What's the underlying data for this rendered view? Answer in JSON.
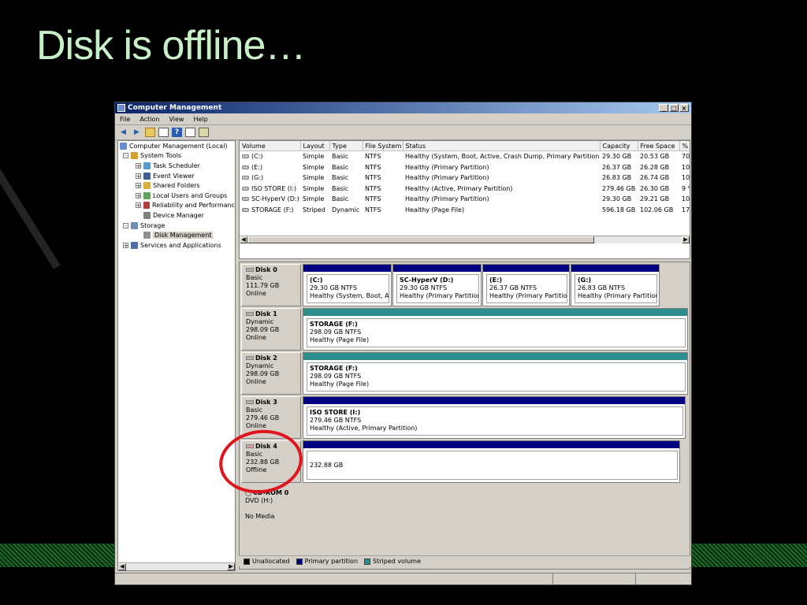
{
  "slide": {
    "title": "Disk is offline…"
  },
  "window": {
    "title": "Computer Management",
    "controls": {
      "minimize": "_",
      "maximize": "□",
      "close": "×"
    }
  },
  "menu": [
    "File",
    "Action",
    "View",
    "Help"
  ],
  "tree": [
    {
      "label": "Computer Management (Local)",
      "icon": "computer-icon"
    },
    {
      "label": "System Tools",
      "icon": "tools-icon",
      "expander": "-"
    },
    {
      "label": "Task Scheduler",
      "icon": "clock-icon",
      "expander": "+"
    },
    {
      "label": "Event Viewer",
      "icon": "event-viewer-icon",
      "expander": "+"
    },
    {
      "label": "Shared Folders",
      "icon": "shared-folder-icon",
      "expander": "+"
    },
    {
      "label": "Local Users and Groups",
      "icon": "users-icon",
      "expander": "+"
    },
    {
      "label": "Reliability and Performanc",
      "icon": "performance-icon",
      "expander": "+"
    },
    {
      "label": "Device Manager",
      "icon": "device-manager-icon"
    },
    {
      "label": "Storage",
      "icon": "storage-icon",
      "expander": "-"
    },
    {
      "label": "Disk Management",
      "icon": "disk-management-icon",
      "selected": true
    },
    {
      "label": "Services and Applications",
      "icon": "services-icon",
      "expander": "+"
    }
  ],
  "volume_table": {
    "headers": [
      "Volume",
      "Layout",
      "Type",
      "File System",
      "Status",
      "Capacity",
      "Free Space",
      "%"
    ],
    "rows": [
      [
        "(C:)",
        "Simple",
        "Basic",
        "NTFS",
        "Healthy (System, Boot, Active, Crash Dump, Primary Partition)",
        "29.30 GB",
        "20.53 GB",
        "70"
      ],
      [
        "(E:)",
        "Simple",
        "Basic",
        "NTFS",
        "Healthy (Primary Partition)",
        "26.37 GB",
        "26.28 GB",
        "10"
      ],
      [
        "(G:)",
        "Simple",
        "Basic",
        "NTFS",
        "Healthy (Primary Partition)",
        "26.83 GB",
        "26.74 GB",
        "10"
      ],
      [
        "ISO STORE (I:)",
        "Simple",
        "Basic",
        "NTFS",
        "Healthy (Active, Primary Partition)",
        "279.46 GB",
        "26.30 GB",
        "9 %"
      ],
      [
        "SC-HyperV (D:)",
        "Simple",
        "Basic",
        "NTFS",
        "Healthy (Primary Partition)",
        "29.30 GB",
        "29.21 GB",
        "10"
      ],
      [
        "STORAGE (F:)",
        "Striped",
        "Dynamic",
        "NTFS",
        "Healthy (Page File)",
        "596.18 GB",
        "102.06 GB",
        "17"
      ]
    ]
  },
  "disks": [
    {
      "name": "Disk 0",
      "type": "Basic",
      "size": "111.79 GB",
      "status": "Online",
      "partitions": [
        {
          "name": "(C:)",
          "size": "29.30 GB NTFS",
          "status": "Healthy (System, Boot, Ac",
          "kind": "primary"
        },
        {
          "name": "SC-HyperV  (D:)",
          "size": "29.30 GB NTFS",
          "status": "Healthy (Primary Partition)",
          "kind": "primary"
        },
        {
          "name": "(E:)",
          "size": "26.37 GB NTFS",
          "status": "Healthy (Primary Partition)",
          "kind": "primary"
        },
        {
          "name": "(G:)",
          "size": "26.83 GB NTFS",
          "status": "Healthy (Primary Partition)",
          "kind": "primary"
        }
      ]
    },
    {
      "name": "Disk 1",
      "type": "Dynamic",
      "size": "298.09 GB",
      "status": "Online",
      "partitions": [
        {
          "name": "STORAGE  (F:)",
          "size": "298.09 GB NTFS",
          "status": "Healthy (Page File)",
          "kind": "striped"
        }
      ]
    },
    {
      "name": "Disk 2",
      "type": "Dynamic",
      "size": "298.09 GB",
      "status": "Online",
      "partitions": [
        {
          "name": "STORAGE  (F:)",
          "size": "298.09 GB NTFS",
          "status": "Healthy (Page File)",
          "kind": "striped"
        }
      ]
    },
    {
      "name": "Disk 3",
      "type": "Basic",
      "size": "279.46 GB",
      "status": "Online",
      "partitions": [
        {
          "name": "ISO STORE  (I:)",
          "size": "279.46 GB NTFS",
          "status": "Healthy (Active, Primary Partition)",
          "kind": "primary"
        }
      ]
    },
    {
      "name": "Disk 4",
      "type": "Basic",
      "size": "232.88 GB",
      "status": "Offline",
      "partitions": [
        {
          "name": "",
          "size": "232.88 GB",
          "status": "",
          "kind": "primary"
        }
      ]
    }
  ],
  "cdrom": {
    "name": "CD-ROM 0",
    "type": "DVD (H:)",
    "status": "No Media"
  },
  "legend": [
    {
      "label": "Unallocated",
      "color": "#000000"
    },
    {
      "label": "Primary partition",
      "color": "#000080"
    },
    {
      "label": "Striped volume",
      "color": "#2b8f8f"
    }
  ],
  "colors": {
    "highlight_circle": "#e0141c",
    "title_text": "#c8f0c8"
  }
}
